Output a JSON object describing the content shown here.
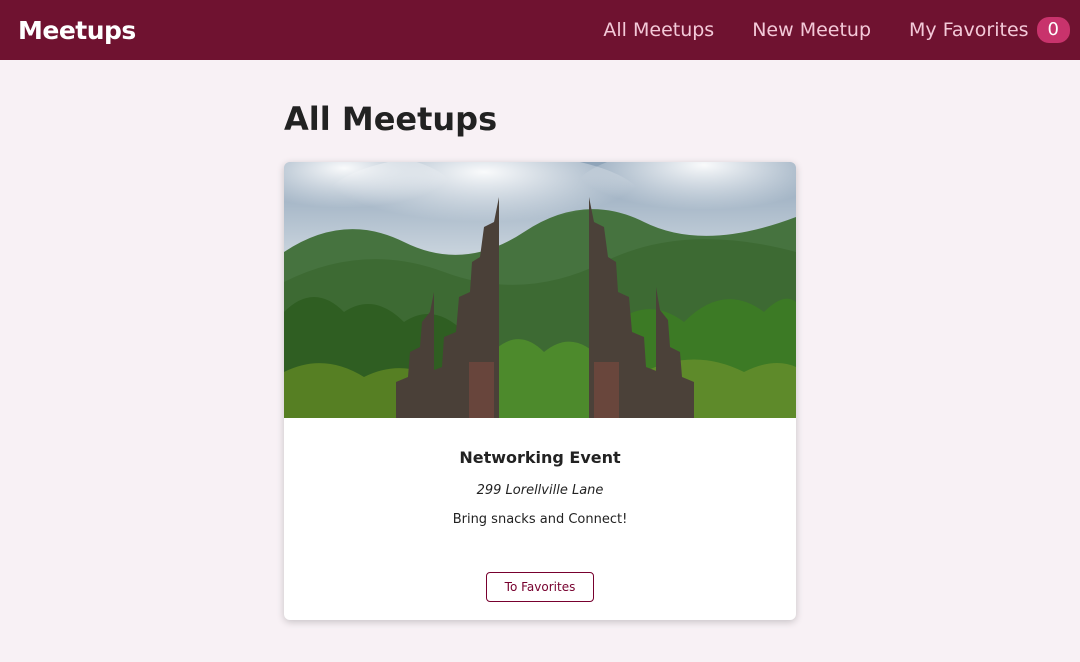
{
  "header": {
    "logo": "Meetups",
    "nav": {
      "all_meetups": "All Meetups",
      "new_meetup": "New Meetup",
      "my_favorites": "My Favorites",
      "favorites_count": "0"
    }
  },
  "main": {
    "title": "All Meetups",
    "meetups": [
      {
        "image": "temple-gate-jungle-photo",
        "title": "Networking Event",
        "address": "299 Lorellville Lane",
        "description": "Bring snacks and Connect!",
        "favorite_button": "To Favorites"
      }
    ]
  },
  "colors": {
    "header_bg": "#6f1230",
    "nav_link": "#f3c9d8",
    "badge_bg": "#c8336c",
    "page_bg": "#f8f1f5",
    "button_accent": "#77002e"
  }
}
